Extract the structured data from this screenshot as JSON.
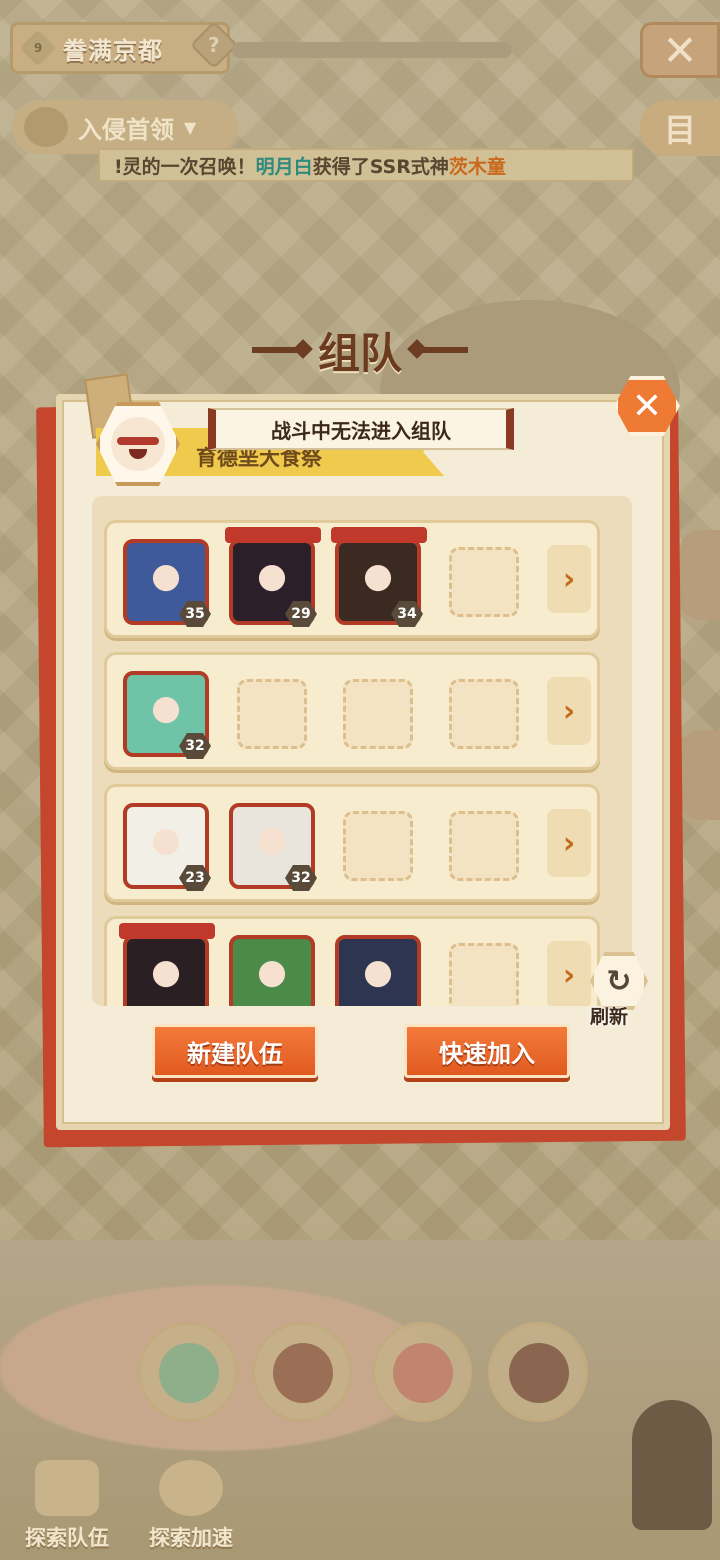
{
  "header": {
    "level": "9",
    "area_name": "誊满京都",
    "help_symbol": "?",
    "close_symbol": "✕",
    "boss_dropdown_label": "入侵首领",
    "boss_dropdown_chevron": "▼",
    "menu_symbol": "目"
  },
  "ticker": {
    "prefix": "!灵的一次召唤！",
    "player": "明月白",
    "middle": "获得了SSR式神",
    "shikigami": "茨木童"
  },
  "panel": {
    "title": "组队",
    "banner_name": "育德垩大食祭",
    "toast": "战斗中无法进入组队",
    "close_symbol": "✕"
  },
  "teams": [
    {
      "members": [
        {
          "level": "35",
          "color": "#3e5a9a"
        },
        {
          "level": "29",
          "color": "#2b1f2a"
        },
        {
          "level": "34",
          "color": "#3b2a22"
        }
      ],
      "empty_slots": 1
    },
    {
      "members": [
        {
          "level": "32",
          "color": "#6fc4a8"
        }
      ],
      "empty_slots": 3
    },
    {
      "members": [
        {
          "level": "23",
          "color": "#f2efe6"
        },
        {
          "level": "32",
          "color": "#e9e4dc"
        }
      ],
      "empty_slots": 2
    },
    {
      "members": [
        {
          "level": "",
          "color": "#2a1f22"
        },
        {
          "level": "",
          "color": "#4c8a4a"
        },
        {
          "level": "",
          "color": "#2d3550"
        }
      ],
      "empty_slots": 1
    }
  ],
  "row_arrow_symbol": "›",
  "refresh": {
    "symbol": "↻",
    "label": "刷新"
  },
  "buttons": {
    "create_team": "新建队伍",
    "quick_join": "快速加入"
  },
  "bottom": {
    "explore_team": "探索队伍",
    "explore_speed": "探索加速"
  },
  "colors": {
    "accent_orange": "#ef7a33",
    "board_red": "#c3462d",
    "highlight_teal": "#2f8a7c",
    "highlight_orange": "#c9691b"
  }
}
